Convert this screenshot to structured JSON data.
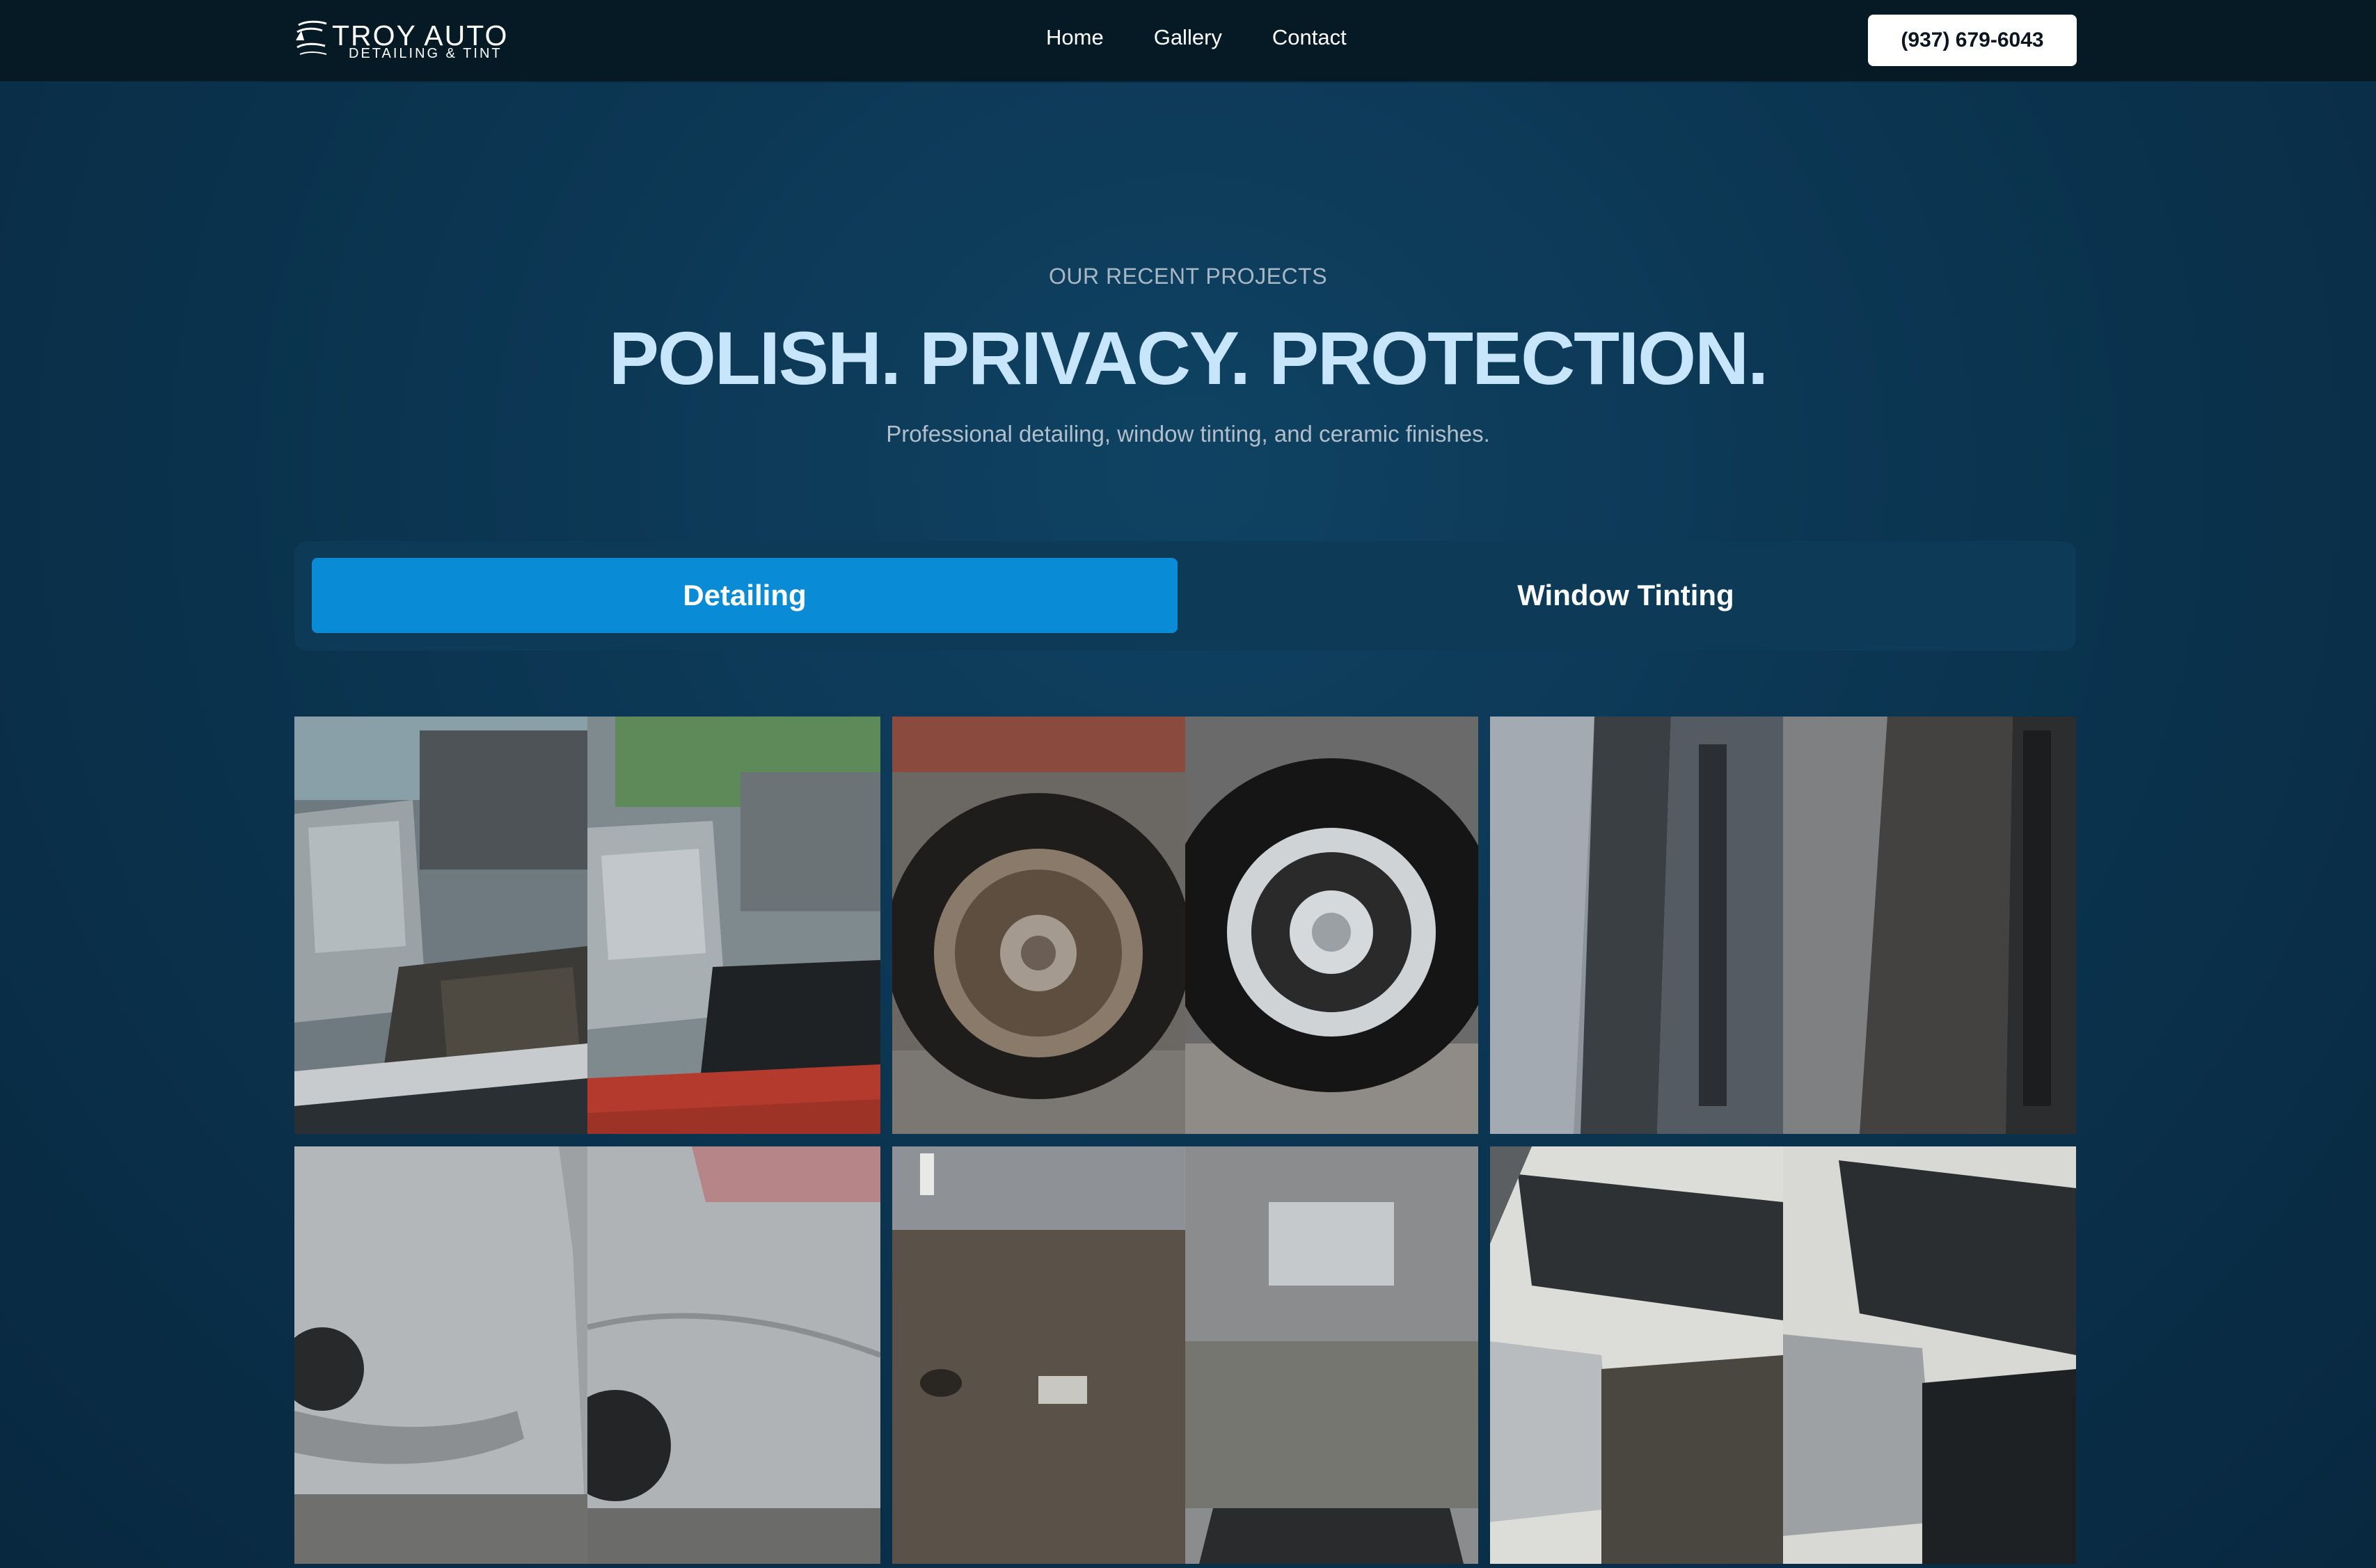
{
  "brand": {
    "title": "TROY AUTO",
    "subtitle": "DETAILING & TINT",
    "mark_icon": "car-swoosh-icon"
  },
  "nav": {
    "items": [
      {
        "label": "Home"
      },
      {
        "label": "Gallery"
      },
      {
        "label": "Contact"
      }
    ]
  },
  "phone": {
    "label": "(937) 679-6043"
  },
  "hero": {
    "kicker": "OUR RECENT PROJECTS",
    "headline": "POLISH. PRIVACY. PROTECTION.",
    "subline": "Professional detailing, window tinting, and ceramic finishes."
  },
  "tabs": [
    {
      "label": "Detailing",
      "active": true
    },
    {
      "label": "Window Tinting",
      "active": false
    }
  ],
  "colors": {
    "accent": "#0a8bd6",
    "headline": "#c8e6fb",
    "header_bg": "#061a26",
    "page_bg": "#0b3551"
  },
  "gallery": {
    "items": [
      {
        "subject": "truck interior floor before and after"
      },
      {
        "subject": "truck wheel before and after"
      },
      {
        "subject": "seat carpet before and after"
      },
      {
        "subject": "minivan rear bumper before and after"
      },
      {
        "subject": "van cargo floor before and after"
      },
      {
        "subject": "SUV interior before and after"
      }
    ]
  }
}
